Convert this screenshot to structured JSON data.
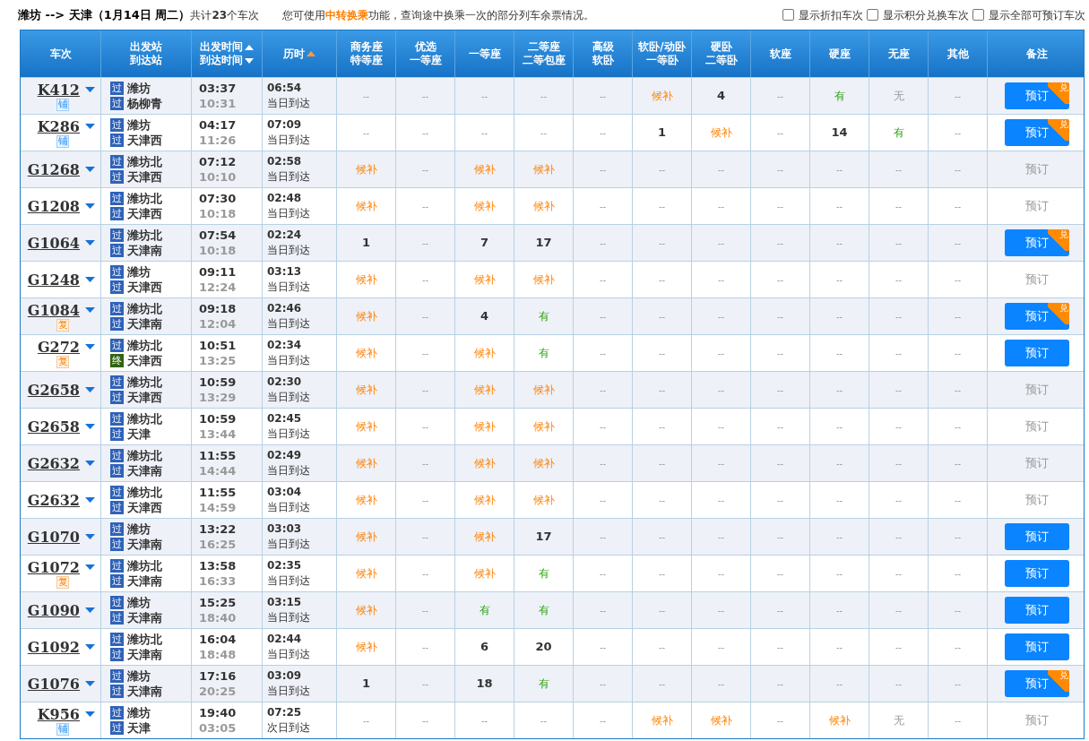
{
  "summary": {
    "route": "潍坊 --> 天津（1月14日  周二）",
    "count": "共计**23**个车次",
    "notice": "您可使用**中转换乘**功能，查询途中换乘一次的部分列车余票情况。"
  },
  "filters": [
    {
      "label": "显示折扣车次",
      "checked": false
    },
    {
      "label": "显示积分兑换车次",
      "checked": false
    },
    {
      "label": "显示全部可预订车次",
      "checked": false
    }
  ],
  "columns": [
    {
      "lines": [
        {
          "text": "车次"
        }
      ]
    },
    {
      "lines": [
        {
          "text": "出发站"
        },
        {
          "text": "到达站"
        }
      ]
    },
    {
      "lines": [
        {
          "text": "出发时间",
          "kind": "sort_up",
          "active": false
        },
        {
          "text": "到达时间",
          "kind": "sort_down",
          "active": false
        }
      ]
    },
    {
      "lines": [
        {
          "text": "历时",
          "kind": "sort_up",
          "active": true
        }
      ]
    },
    {
      "lines": [
        {
          "text": "商务座"
        },
        {
          "text": "特等座"
        }
      ]
    },
    {
      "lines": [
        {
          "text": "优选"
        },
        {
          "text": "一等座"
        }
      ]
    },
    {
      "lines": [
        {
          "text": "一等座"
        }
      ]
    },
    {
      "lines": [
        {
          "text": "二等座"
        },
        {
          "text": "二等包座"
        }
      ]
    },
    {
      "lines": [
        {
          "text": "高级"
        },
        {
          "text": "软卧"
        }
      ]
    },
    {
      "lines": [
        {
          "text": "软卧/动卧"
        },
        {
          "text": "一等卧"
        }
      ]
    },
    {
      "lines": [
        {
          "text": "硬卧"
        },
        {
          "text": "二等卧"
        }
      ]
    },
    {
      "lines": [
        {
          "text": "软座"
        }
      ]
    },
    {
      "lines": [
        {
          "text": "硬座"
        }
      ]
    },
    {
      "lines": [
        {
          "text": "无座"
        }
      ]
    },
    {
      "lines": [
        {
          "text": "其他"
        }
      ]
    },
    {
      "lines": [
        {
          "text": "备注"
        }
      ]
    }
  ],
  "trains": [
    {
      "number": "K412",
      "tag": {
        "kind": "sleeper",
        "text": "铺"
      },
      "from": {
        "kind": "pass",
        "badge": "过",
        "name": "潍坊"
      },
      "to": {
        "kind": "pass",
        "badge": "过",
        "name": "杨柳青"
      },
      "depart": "03:37",
      "arrive": "10:31",
      "duration": "06:54",
      "arrival_day": "当日到达",
      "seats": [
        {
          "kind": "none",
          "text": "--"
        },
        {
          "kind": "none",
          "text": "--"
        },
        {
          "kind": "none",
          "text": "--"
        },
        {
          "kind": "none",
          "text": "--"
        },
        {
          "kind": "none",
          "text": "--"
        },
        {
          "kind": "waitlist",
          "text": "候补"
        },
        {
          "kind": "count",
          "text": "4"
        },
        {
          "kind": "none",
          "text": "--"
        },
        {
          "kind": "available",
          "text": "有"
        },
        {
          "kind": "sold_out",
          "text": "无"
        },
        {
          "kind": "none",
          "text": "--"
        }
      ],
      "book": {
        "label": "预订",
        "enabled": true,
        "badge": "兑"
      }
    },
    {
      "number": "K286",
      "tag": {
        "kind": "sleeper",
        "text": "铺"
      },
      "from": {
        "kind": "pass",
        "badge": "过",
        "name": "潍坊"
      },
      "to": {
        "kind": "pass",
        "badge": "过",
        "name": "天津西"
      },
      "depart": "04:17",
      "arrive": "11:26",
      "duration": "07:09",
      "arrival_day": "当日到达",
      "seats": [
        {
          "kind": "none",
          "text": "--"
        },
        {
          "kind": "none",
          "text": "--"
        },
        {
          "kind": "none",
          "text": "--"
        },
        {
          "kind": "none",
          "text": "--"
        },
        {
          "kind": "none",
          "text": "--"
        },
        {
          "kind": "count",
          "text": "1"
        },
        {
          "kind": "waitlist",
          "text": "候补"
        },
        {
          "kind": "none",
          "text": "--"
        },
        {
          "kind": "count",
          "text": "14"
        },
        {
          "kind": "available",
          "text": "有"
        },
        {
          "kind": "none",
          "text": "--"
        }
      ],
      "book": {
        "label": "预订",
        "enabled": true,
        "badge": "兑"
      }
    },
    {
      "number": "G1268",
      "from": {
        "kind": "pass",
        "badge": "过",
        "name": "潍坊北"
      },
      "to": {
        "kind": "pass",
        "badge": "过",
        "name": "天津西"
      },
      "depart": "07:12",
      "arrive": "10:10",
      "duration": "02:58",
      "arrival_day": "当日到达",
      "seats": [
        {
          "kind": "waitlist",
          "text": "候补"
        },
        {
          "kind": "none",
          "text": "--"
        },
        {
          "kind": "waitlist",
          "text": "候补"
        },
        {
          "kind": "waitlist",
          "text": "候补"
        },
        {
          "kind": "none",
          "text": "--"
        },
        {
          "kind": "none",
          "text": "--"
        },
        {
          "kind": "none",
          "text": "--"
        },
        {
          "kind": "none",
          "text": "--"
        },
        {
          "kind": "none",
          "text": "--"
        },
        {
          "kind": "none",
          "text": "--"
        },
        {
          "kind": "none",
          "text": "--"
        }
      ],
      "book": {
        "label": "预订",
        "enabled": false
      }
    },
    {
      "number": "G1208",
      "from": {
        "kind": "pass",
        "badge": "过",
        "name": "潍坊北"
      },
      "to": {
        "kind": "pass",
        "badge": "过",
        "name": "天津西"
      },
      "depart": "07:30",
      "arrive": "10:18",
      "duration": "02:48",
      "arrival_day": "当日到达",
      "seats": [
        {
          "kind": "waitlist",
          "text": "候补"
        },
        {
          "kind": "none",
          "text": "--"
        },
        {
          "kind": "waitlist",
          "text": "候补"
        },
        {
          "kind": "waitlist",
          "text": "候补"
        },
        {
          "kind": "none",
          "text": "--"
        },
        {
          "kind": "none",
          "text": "--"
        },
        {
          "kind": "none",
          "text": "--"
        },
        {
          "kind": "none",
          "text": "--"
        },
        {
          "kind": "none",
          "text": "--"
        },
        {
          "kind": "none",
          "text": "--"
        },
        {
          "kind": "none",
          "text": "--"
        }
      ],
      "book": {
        "label": "预订",
        "enabled": false
      }
    },
    {
      "number": "G1064",
      "from": {
        "kind": "pass",
        "badge": "过",
        "name": "潍坊北"
      },
      "to": {
        "kind": "pass",
        "badge": "过",
        "name": "天津南"
      },
      "depart": "07:54",
      "arrive": "10:18",
      "duration": "02:24",
      "arrival_day": "当日到达",
      "seats": [
        {
          "kind": "count",
          "text": "1"
        },
        {
          "kind": "none",
          "text": "--"
        },
        {
          "kind": "count",
          "text": "7"
        },
        {
          "kind": "count",
          "text": "17"
        },
        {
          "kind": "none",
          "text": "--"
        },
        {
          "kind": "none",
          "text": "--"
        },
        {
          "kind": "none",
          "text": "--"
        },
        {
          "kind": "none",
          "text": "--"
        },
        {
          "kind": "none",
          "text": "--"
        },
        {
          "kind": "none",
          "text": "--"
        },
        {
          "kind": "none",
          "text": "--"
        }
      ],
      "book": {
        "label": "预订",
        "enabled": true,
        "badge": "兑"
      }
    },
    {
      "number": "G1248",
      "from": {
        "kind": "pass",
        "badge": "过",
        "name": "潍坊"
      },
      "to": {
        "kind": "pass",
        "badge": "过",
        "name": "天津西"
      },
      "depart": "09:11",
      "arrive": "12:24",
      "duration": "03:13",
      "arrival_day": "当日到达",
      "seats": [
        {
          "kind": "waitlist",
          "text": "候补"
        },
        {
          "kind": "none",
          "text": "--"
        },
        {
          "kind": "waitlist",
          "text": "候补"
        },
        {
          "kind": "waitlist",
          "text": "候补"
        },
        {
          "kind": "none",
          "text": "--"
        },
        {
          "kind": "none",
          "text": "--"
        },
        {
          "kind": "none",
          "text": "--"
        },
        {
          "kind": "none",
          "text": "--"
        },
        {
          "kind": "none",
          "text": "--"
        },
        {
          "kind": "none",
          "text": "--"
        },
        {
          "kind": "none",
          "text": "--"
        }
      ],
      "book": {
        "label": "预订",
        "enabled": false
      }
    },
    {
      "number": "G1084",
      "tag": {
        "kind": "reissue",
        "text": "复"
      },
      "from": {
        "kind": "pass",
        "badge": "过",
        "name": "潍坊北"
      },
      "to": {
        "kind": "pass",
        "badge": "过",
        "name": "天津南"
      },
      "depart": "09:18",
      "arrive": "12:04",
      "duration": "02:46",
      "arrival_day": "当日到达",
      "seats": [
        {
          "kind": "waitlist",
          "text": "候补"
        },
        {
          "kind": "none",
          "text": "--"
        },
        {
          "kind": "count",
          "text": "4"
        },
        {
          "kind": "available",
          "text": "有"
        },
        {
          "kind": "none",
          "text": "--"
        },
        {
          "kind": "none",
          "text": "--"
        },
        {
          "kind": "none",
          "text": "--"
        },
        {
          "kind": "none",
          "text": "--"
        },
        {
          "kind": "none",
          "text": "--"
        },
        {
          "kind": "none",
          "text": "--"
        },
        {
          "kind": "none",
          "text": "--"
        }
      ],
      "book": {
        "label": "预订",
        "enabled": true,
        "badge": "兑"
      }
    },
    {
      "number": "G272",
      "tag": {
        "kind": "reissue",
        "text": "复"
      },
      "from": {
        "kind": "pass",
        "badge": "过",
        "name": "潍坊北"
      },
      "to": {
        "kind": "terminal",
        "badge": "终",
        "name": "天津西"
      },
      "depart": "10:51",
      "arrive": "13:25",
      "duration": "02:34",
      "arrival_day": "当日到达",
      "seats": [
        {
          "kind": "waitlist",
          "text": "候补"
        },
        {
          "kind": "none",
          "text": "--"
        },
        {
          "kind": "waitlist",
          "text": "候补"
        },
        {
          "kind": "available",
          "text": "有"
        },
        {
          "kind": "none",
          "text": "--"
        },
        {
          "kind": "none",
          "text": "--"
        },
        {
          "kind": "none",
          "text": "--"
        },
        {
          "kind": "none",
          "text": "--"
        },
        {
          "kind": "none",
          "text": "--"
        },
        {
          "kind": "none",
          "text": "--"
        },
        {
          "kind": "none",
          "text": "--"
        }
      ],
      "book": {
        "label": "预订",
        "enabled": true
      }
    },
    {
      "number": "G2658",
      "from": {
        "kind": "pass",
        "badge": "过",
        "name": "潍坊北"
      },
      "to": {
        "kind": "pass",
        "badge": "过",
        "name": "天津西"
      },
      "depart": "10:59",
      "arrive": "13:29",
      "duration": "02:30",
      "arrival_day": "当日到达",
      "seats": [
        {
          "kind": "waitlist",
          "text": "候补"
        },
        {
          "kind": "none",
          "text": "--"
        },
        {
          "kind": "waitlist",
          "text": "候补"
        },
        {
          "kind": "waitlist",
          "text": "候补"
        },
        {
          "kind": "none",
          "text": "--"
        },
        {
          "kind": "none",
          "text": "--"
        },
        {
          "kind": "none",
          "text": "--"
        },
        {
          "kind": "none",
          "text": "--"
        },
        {
          "kind": "none",
          "text": "--"
        },
        {
          "kind": "none",
          "text": "--"
        },
        {
          "kind": "none",
          "text": "--"
        }
      ],
      "book": {
        "label": "预订",
        "enabled": false
      }
    },
    {
      "number": "G2658",
      "from": {
        "kind": "pass",
        "badge": "过",
        "name": "潍坊北"
      },
      "to": {
        "kind": "pass",
        "badge": "过",
        "name": "天津"
      },
      "depart": "10:59",
      "arrive": "13:44",
      "duration": "02:45",
      "arrival_day": "当日到达",
      "seats": [
        {
          "kind": "waitlist",
          "text": "候补"
        },
        {
          "kind": "none",
          "text": "--"
        },
        {
          "kind": "waitlist",
          "text": "候补"
        },
        {
          "kind": "waitlist",
          "text": "候补"
        },
        {
          "kind": "none",
          "text": "--"
        },
        {
          "kind": "none",
          "text": "--"
        },
        {
          "kind": "none",
          "text": "--"
        },
        {
          "kind": "none",
          "text": "--"
        },
        {
          "kind": "none",
          "text": "--"
        },
        {
          "kind": "none",
          "text": "--"
        },
        {
          "kind": "none",
          "text": "--"
        }
      ],
      "book": {
        "label": "预订",
        "enabled": false
      }
    },
    {
      "number": "G2632",
      "from": {
        "kind": "pass",
        "badge": "过",
        "name": "潍坊北"
      },
      "to": {
        "kind": "pass",
        "badge": "过",
        "name": "天津南"
      },
      "depart": "11:55",
      "arrive": "14:44",
      "duration": "02:49",
      "arrival_day": "当日到达",
      "seats": [
        {
          "kind": "waitlist",
          "text": "候补"
        },
        {
          "kind": "none",
          "text": "--"
        },
        {
          "kind": "waitlist",
          "text": "候补"
        },
        {
          "kind": "waitlist",
          "text": "候补"
        },
        {
          "kind": "none",
          "text": "--"
        },
        {
          "kind": "none",
          "text": "--"
        },
        {
          "kind": "none",
          "text": "--"
        },
        {
          "kind": "none",
          "text": "--"
        },
        {
          "kind": "none",
          "text": "--"
        },
        {
          "kind": "none",
          "text": "--"
        },
        {
          "kind": "none",
          "text": "--"
        }
      ],
      "book": {
        "label": "预订",
        "enabled": false
      }
    },
    {
      "number": "G2632",
      "from": {
        "kind": "pass",
        "badge": "过",
        "name": "潍坊北"
      },
      "to": {
        "kind": "pass",
        "badge": "过",
        "name": "天津西"
      },
      "depart": "11:55",
      "arrive": "14:59",
      "duration": "03:04",
      "arrival_day": "当日到达",
      "seats": [
        {
          "kind": "waitlist",
          "text": "候补"
        },
        {
          "kind": "none",
          "text": "--"
        },
        {
          "kind": "waitlist",
          "text": "候补"
        },
        {
          "kind": "waitlist",
          "text": "候补"
        },
        {
          "kind": "none",
          "text": "--"
        },
        {
          "kind": "none",
          "text": "--"
        },
        {
          "kind": "none",
          "text": "--"
        },
        {
          "kind": "none",
          "text": "--"
        },
        {
          "kind": "none",
          "text": "--"
        },
        {
          "kind": "none",
          "text": "--"
        },
        {
          "kind": "none",
          "text": "--"
        }
      ],
      "book": {
        "label": "预订",
        "enabled": false
      }
    },
    {
      "number": "G1070",
      "from": {
        "kind": "pass",
        "badge": "过",
        "name": "潍坊"
      },
      "to": {
        "kind": "pass",
        "badge": "过",
        "name": "天津南"
      },
      "depart": "13:22",
      "arrive": "16:25",
      "duration": "03:03",
      "arrival_day": "当日到达",
      "seats": [
        {
          "kind": "waitlist",
          "text": "候补"
        },
        {
          "kind": "none",
          "text": "--"
        },
        {
          "kind": "waitlist",
          "text": "候补"
        },
        {
          "kind": "count",
          "text": "17"
        },
        {
          "kind": "none",
          "text": "--"
        },
        {
          "kind": "none",
          "text": "--"
        },
        {
          "kind": "none",
          "text": "--"
        },
        {
          "kind": "none",
          "text": "--"
        },
        {
          "kind": "none",
          "text": "--"
        },
        {
          "kind": "none",
          "text": "--"
        },
        {
          "kind": "none",
          "text": "--"
        }
      ],
      "book": {
        "label": "预订",
        "enabled": true
      }
    },
    {
      "number": "G1072",
      "tag": {
        "kind": "reissue",
        "text": "复"
      },
      "from": {
        "kind": "pass",
        "badge": "过",
        "name": "潍坊北"
      },
      "to": {
        "kind": "pass",
        "badge": "过",
        "name": "天津南"
      },
      "depart": "13:58",
      "arrive": "16:33",
      "duration": "02:35",
      "arrival_day": "当日到达",
      "seats": [
        {
          "kind": "waitlist",
          "text": "候补"
        },
        {
          "kind": "none",
          "text": "--"
        },
        {
          "kind": "waitlist",
          "text": "候补"
        },
        {
          "kind": "available",
          "text": "有"
        },
        {
          "kind": "none",
          "text": "--"
        },
        {
          "kind": "none",
          "text": "--"
        },
        {
          "kind": "none",
          "text": "--"
        },
        {
          "kind": "none",
          "text": "--"
        },
        {
          "kind": "none",
          "text": "--"
        },
        {
          "kind": "none",
          "text": "--"
        },
        {
          "kind": "none",
          "text": "--"
        }
      ],
      "book": {
        "label": "预订",
        "enabled": true
      }
    },
    {
      "number": "G1090",
      "from": {
        "kind": "pass",
        "badge": "过",
        "name": "潍坊"
      },
      "to": {
        "kind": "pass",
        "badge": "过",
        "name": "天津南"
      },
      "depart": "15:25",
      "arrive": "18:40",
      "duration": "03:15",
      "arrival_day": "当日到达",
      "seats": [
        {
          "kind": "waitlist",
          "text": "候补"
        },
        {
          "kind": "none",
          "text": "--"
        },
        {
          "kind": "available",
          "text": "有"
        },
        {
          "kind": "available",
          "text": "有"
        },
        {
          "kind": "none",
          "text": "--"
        },
        {
          "kind": "none",
          "text": "--"
        },
        {
          "kind": "none",
          "text": "--"
        },
        {
          "kind": "none",
          "text": "--"
        },
        {
          "kind": "none",
          "text": "--"
        },
        {
          "kind": "none",
          "text": "--"
        },
        {
          "kind": "none",
          "text": "--"
        }
      ],
      "book": {
        "label": "预订",
        "enabled": true
      }
    },
    {
      "number": "G1092",
      "from": {
        "kind": "pass",
        "badge": "过",
        "name": "潍坊北"
      },
      "to": {
        "kind": "pass",
        "badge": "过",
        "name": "天津南"
      },
      "depart": "16:04",
      "arrive": "18:48",
      "duration": "02:44",
      "arrival_day": "当日到达",
      "seats": [
        {
          "kind": "waitlist",
          "text": "候补"
        },
        {
          "kind": "none",
          "text": "--"
        },
        {
          "kind": "count",
          "text": "6"
        },
        {
          "kind": "count",
          "text": "20"
        },
        {
          "kind": "none",
          "text": "--"
        },
        {
          "kind": "none",
          "text": "--"
        },
        {
          "kind": "none",
          "text": "--"
        },
        {
          "kind": "none",
          "text": "--"
        },
        {
          "kind": "none",
          "text": "--"
        },
        {
          "kind": "none",
          "text": "--"
        },
        {
          "kind": "none",
          "text": "--"
        }
      ],
      "book": {
        "label": "预订",
        "enabled": true
      }
    },
    {
      "number": "G1076",
      "from": {
        "kind": "pass",
        "badge": "过",
        "name": "潍坊"
      },
      "to": {
        "kind": "pass",
        "badge": "过",
        "name": "天津南"
      },
      "depart": "17:16",
      "arrive": "20:25",
      "duration": "03:09",
      "arrival_day": "当日到达",
      "seats": [
        {
          "kind": "count",
          "text": "1"
        },
        {
          "kind": "none",
          "text": "--"
        },
        {
          "kind": "count",
          "text": "18"
        },
        {
          "kind": "available",
          "text": "有"
        },
        {
          "kind": "none",
          "text": "--"
        },
        {
          "kind": "none",
          "text": "--"
        },
        {
          "kind": "none",
          "text": "--"
        },
        {
          "kind": "none",
          "text": "--"
        },
        {
          "kind": "none",
          "text": "--"
        },
        {
          "kind": "none",
          "text": "--"
        },
        {
          "kind": "none",
          "text": "--"
        }
      ],
      "book": {
        "label": "预订",
        "enabled": true,
        "badge": "兑"
      }
    },
    {
      "number": "K956",
      "tag": {
        "kind": "sleeper",
        "text": "铺"
      },
      "from": {
        "kind": "pass",
        "badge": "过",
        "name": "潍坊"
      },
      "to": {
        "kind": "pass",
        "badge": "过",
        "name": "天津"
      },
      "depart": "19:40",
      "arrive": "03:05",
      "duration": "07:25",
      "arrival_day": "次日到达",
      "seats": [
        {
          "kind": "none",
          "text": "--"
        },
        {
          "kind": "none",
          "text": "--"
        },
        {
          "kind": "none",
          "text": "--"
        },
        {
          "kind": "none",
          "text": "--"
        },
        {
          "kind": "none",
          "text": "--"
        },
        {
          "kind": "waitlist",
          "text": "候补"
        },
        {
          "kind": "waitlist",
          "text": "候补"
        },
        {
          "kind": "none",
          "text": "--"
        },
        {
          "kind": "waitlist",
          "text": "候补"
        },
        {
          "kind": "sold_out",
          "text": "无"
        },
        {
          "kind": "none",
          "text": "--"
        }
      ],
      "book": {
        "label": "预订",
        "enabled": false
      }
    }
  ]
}
